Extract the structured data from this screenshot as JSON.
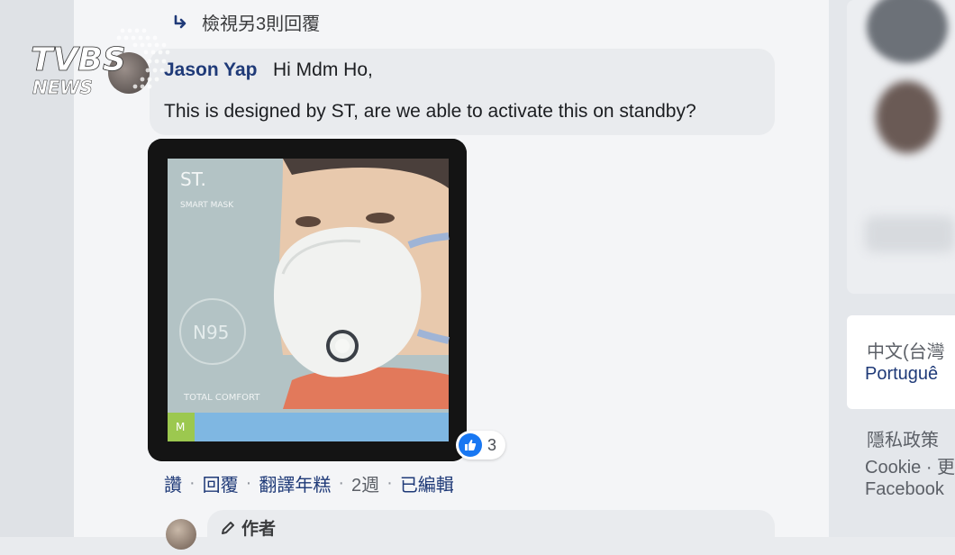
{
  "thread": {
    "view_more_replies": "檢視另3則回覆"
  },
  "comment": {
    "author": "Jason Yap",
    "greeting": "Hi Mdm Ho,",
    "text": "This is designed by ST, are we able to activate this on standby?",
    "image": {
      "box_brand": "ST.",
      "box_subtitle": "SMART MASK",
      "badge": "N95",
      "tagline": "TOTAL COMFORT",
      "size_label": "M"
    },
    "reactions": {
      "icon": "like-icon",
      "count": "3"
    },
    "actions": {
      "like": "讚",
      "reply": "回覆",
      "translate": "翻譯年糕",
      "time": "2週",
      "edited": "已編輯"
    }
  },
  "next_reply": {
    "author_badge": "作者"
  },
  "right_column": {
    "language_current": "中文(台灣",
    "language_alt": "Portuguê",
    "footer_privacy": "隱私政策",
    "footer_cookie": "Cookie · 更",
    "footer_facebook": "Facebook"
  },
  "watermark": {
    "line1": "TVBS",
    "line2": "NEWS"
  },
  "colors": {
    "link_blue": "#1f3a78",
    "like_blue": "#1877f2",
    "bubble_gray": "#e9ebee",
    "feed_bg": "#f4f5f7"
  }
}
